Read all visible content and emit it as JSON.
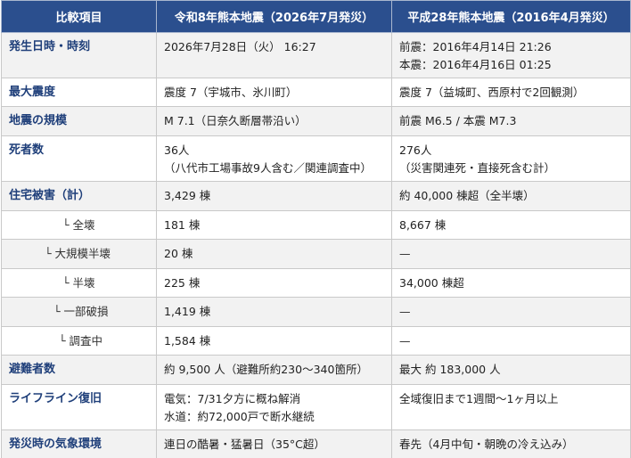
{
  "header": {
    "col1": "比較項目",
    "col2": "令和8年熊本地震（2026年7月発災）",
    "col3": "平成28年熊本地震（2016年4月発災）"
  },
  "rows": [
    {
      "label": "発生日時・時刻",
      "a": [
        "2026年7月28日（火） 16:27"
      ],
      "b": [
        "前震：2016年4月14日 21:26",
        "本震：2016年4月16日 01:25"
      ]
    },
    {
      "label": "最大震度",
      "a": [
        "震度 7（宇城市、氷川町）"
      ],
      "b": [
        "震度 7（益城町、西原村で2回観測）"
      ]
    },
    {
      "label": "地震の規模",
      "a": [
        "M 7.1（日奈久断層帯沿い）"
      ],
      "b": [
        "前震 M6.5 / 本震 M7.3"
      ]
    },
    {
      "label": "死者数",
      "a": [
        "36人",
        "（八代市工場事故9人含む／関連調査中）"
      ],
      "b": [
        "276人",
        "（災害関連死・直接死含む計）"
      ]
    },
    {
      "label": "住宅被害（計）",
      "a": [
        "3,429 棟"
      ],
      "b": [
        "約 40,000 棟超（全半壊）"
      ]
    },
    {
      "label": "└ 全壊",
      "a": [
        "181 棟"
      ],
      "b": [
        "8,667 棟"
      ]
    },
    {
      "label": "└ 大規模半壊",
      "a": [
        "20 棟"
      ],
      "b": [
        "—"
      ]
    },
    {
      "label": "└ 半壊",
      "a": [
        "225 棟"
      ],
      "b": [
        "34,000 棟超"
      ]
    },
    {
      "label": "└ 一部破損",
      "a": [
        "1,419 棟"
      ],
      "b": [
        "—"
      ]
    },
    {
      "label": "└ 調査中",
      "a": [
        "1,584 棟"
      ],
      "b": [
        "—"
      ]
    },
    {
      "label": "避難者数",
      "a": [
        "約 9,500 人（避難所約230〜340箇所）"
      ],
      "b": [
        "最大 約 183,000 人"
      ]
    },
    {
      "label": "ライフライン復旧",
      "a": [
        "電気：7/31夕方に概ね解消",
        "水道：約72,000戸で断水継続"
      ],
      "b": [
        "全域復旧まで1週間〜1ヶ月以上"
      ]
    },
    {
      "label": "発災時の気象環境",
      "a": [
        "連日の酷暑・猛暑日（35°C超）"
      ],
      "b": [
        "春先（4月中旬・朝晩の冷え込み）"
      ]
    }
  ]
}
